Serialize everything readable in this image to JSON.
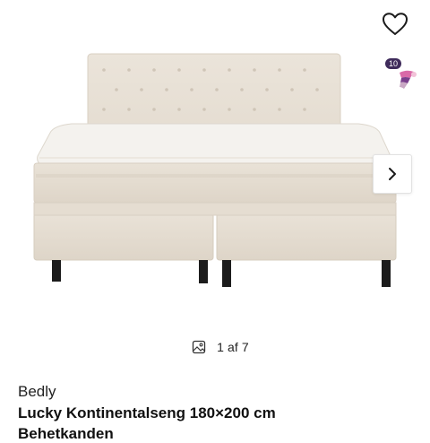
{
  "gallery": {
    "image_alt": "Lucky Kontinentalseng 180×200 cm",
    "swatch_count": "10",
    "counter": "1 af 7"
  },
  "product": {
    "brand": "Bedly",
    "title": "Lucky Kontinentalseng 180×200 cm",
    "subtitle": "Behetkanden"
  },
  "colors": {
    "swatch_badge": "#3f2b5b",
    "bed_fabric": "#e8e1d6",
    "mattress": "#f3f1ec"
  }
}
